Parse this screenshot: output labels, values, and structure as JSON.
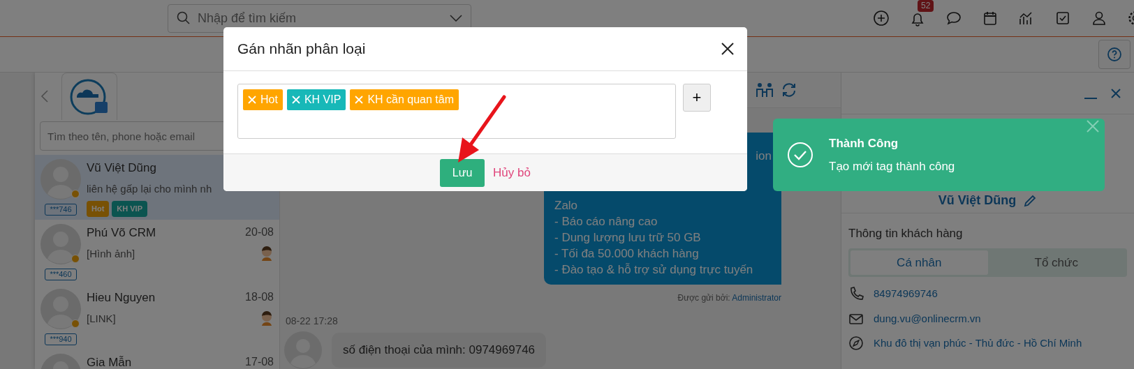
{
  "topbar": {
    "search_placeholder": "Nhập để tìm kiếm",
    "notification_count": "52"
  },
  "contacts": {
    "search_placeholder": "Tìm theo tên, phone hoặc email",
    "items": [
      {
        "name": "Vũ Việt Dũng",
        "preview": "liên hệ gấp lại cho mình nh",
        "code": "***746",
        "status_dot": true,
        "selected": true,
        "tags": [
          {
            "label": "Hot",
            "kind": "hot"
          },
          {
            "label": "KH VIP",
            "kind": "vip"
          }
        ]
      },
      {
        "name": "Phú Võ CRM",
        "preview": "[Hình ảnh]",
        "date": "20-08",
        "code": "***460",
        "status_dot": true,
        "selected": false
      },
      {
        "name": "Hieu Nguyen",
        "preview": "[LINK]",
        "date": "18-08",
        "code": "***940",
        "status_dot": true,
        "selected": false
      },
      {
        "name": "Gia Mẫn",
        "date": "17-08",
        "selected": false
      }
    ]
  },
  "conversation": {
    "bubble_fragment": "ion",
    "bubble_lines": [
      "Zalo",
      "- Báo cáo nâng cao",
      "- Dung lượng lưu trữ 50 GB",
      "- Tối đa 50.000 khách hàng",
      "- Đào tạo & hỗ trợ sử dụng trực tuyến"
    ],
    "sent_by_label": "Được gửi bởi:",
    "sent_by": "Administrator",
    "timestamp": "08-22 17:28",
    "incoming": "số điện thoại của mình: 0974969746"
  },
  "customer": {
    "name": "Vũ Việt Dũng",
    "section_title": "Thông tin khách hàng",
    "tabs": [
      {
        "label": "Cá nhân",
        "selected": true
      },
      {
        "label": "Tổ chức",
        "selected": false
      }
    ],
    "fields": [
      {
        "kind": "phone",
        "value": "84974969746"
      },
      {
        "kind": "email",
        "value": "dung.vu@onlinecrm.vn"
      },
      {
        "kind": "address",
        "value": "Khu đô thị vạn phúc - Thủ đức - Hồ Chí Minh"
      }
    ]
  },
  "modal": {
    "title": "Gán nhãn phân loại",
    "tags": [
      {
        "label": "Hot",
        "color": "#ffa500"
      },
      {
        "label": "KH VIP",
        "color": "#17b8b8"
      },
      {
        "label": "KH cần quan tâm",
        "color": "#ffa500"
      }
    ],
    "add_button": "+",
    "save_button": "Lưu",
    "cancel_button": "Hủy bỏ"
  },
  "toast": {
    "title": "Thành Công",
    "message": "Tạo mới tag thành công"
  }
}
